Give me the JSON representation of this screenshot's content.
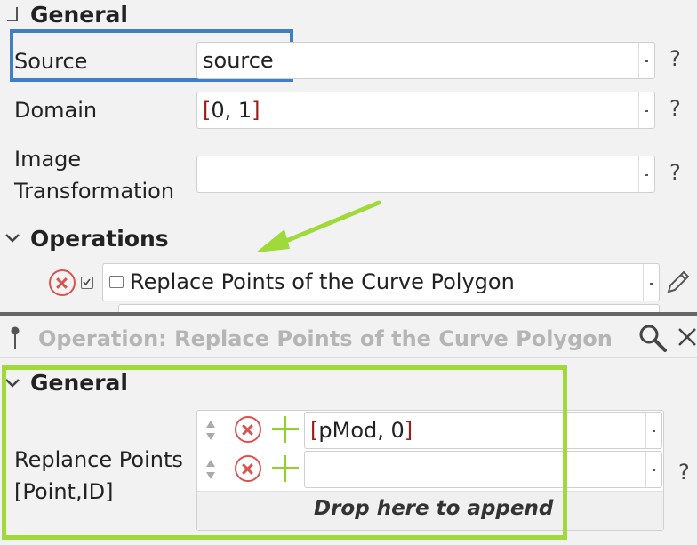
{
  "top_panel": {
    "general_title": "General",
    "source_label": "Source",
    "source_value": "source",
    "domain_label": "Domain",
    "domain_value_open": "[",
    "domain_value_inner": "0, 1",
    "domain_value_close": "]",
    "image_transformation_label_line1": "Image",
    "image_transformation_label_line2": "Transformation",
    "image_transformation_value": "",
    "operations_title": "Operations",
    "operation_item_label": "Replace Points of the Curve Polygon",
    "help": "?"
  },
  "bottom_panel": {
    "header_title": "Operation: Replace Points of the Curve Polygon",
    "general_title": "General",
    "replace_points_label_line1": "Replance Points",
    "replace_points_label_line2": "[Point,ID]",
    "row1_open": "[",
    "row1_inner": "pMod, 0",
    "row1_close": "]",
    "row2_value": "",
    "drop_text": "Drop here to append",
    "help": "?"
  },
  "colors": {
    "highlight_blue": "#3f7fc8",
    "highlight_green": "#9fd93a",
    "arrow_green": "#9fd93a",
    "remove_red": "#d9534f",
    "add_green": "#8fd22e",
    "bracket_red": "#9b1c1c"
  }
}
